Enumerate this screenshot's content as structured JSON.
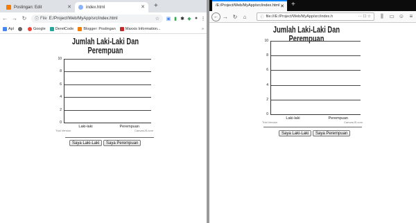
{
  "left": {
    "tabs": [
      {
        "title": "Postingan: Edit"
      },
      {
        "title": "index.html"
      }
    ],
    "new_tab_symbol": "+",
    "omnibox": {
      "label": "File",
      "url": "E:/Project/Web/MyApp/src/index.html"
    },
    "bookmarks": [
      "Apl",
      "Google",
      "DeretCode",
      "Blogger: Postingan",
      "Maxxis Information..."
    ],
    "bookmarks_more": "»"
  },
  "right": {
    "tab_title": "/E:/Project/Web/MyApp/src/index.html",
    "url": "file:///E:/Project/Web/MyApp/src/index.h"
  },
  "chart_data": {
    "type": "bar",
    "title": "Jumlah Laki-Laki Dan Perempuan",
    "categories": [
      "Laki-laki",
      "Perempuan"
    ],
    "values": [
      0,
      0
    ],
    "ylim": [
      0,
      10
    ],
    "yticks": [
      "10",
      "8",
      "6",
      "4",
      "2",
      "0"
    ],
    "grid": true,
    "trial_text": "Trial Version",
    "credit_text": "CanvasJS.com"
  },
  "buttons": {
    "male": "Saya Laki-Laki",
    "female": "Saya Perempuan"
  },
  "colors": {
    "chrome_tab_bg": "#dee1e6",
    "firefox_tab_bg": "#0c0c0d",
    "firefox_accent": "#0a84ff"
  }
}
